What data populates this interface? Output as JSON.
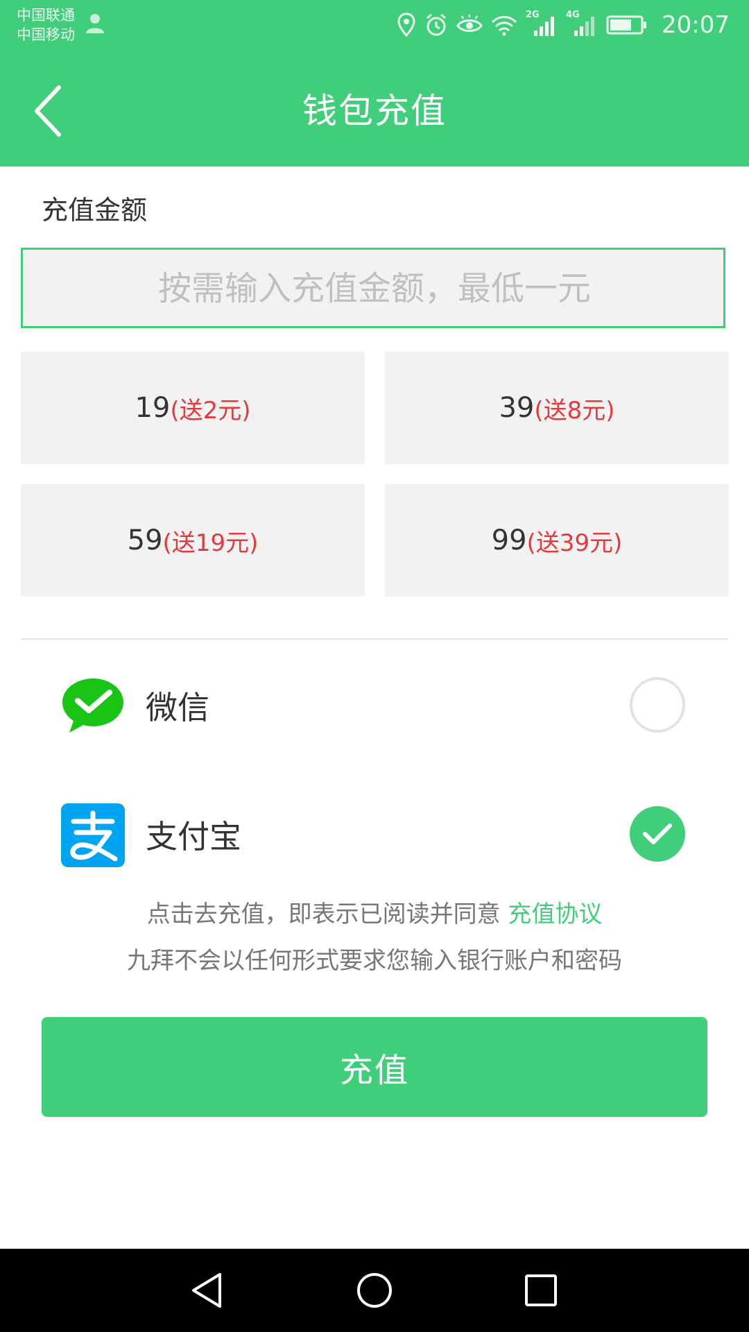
{
  "status_bar": {
    "carrier_1": "中国联通",
    "carrier_2": "中国移动",
    "network_1": "2G",
    "network_2": "4G",
    "time": "20:07"
  },
  "toolbar": {
    "title": "钱包充值"
  },
  "amount": {
    "label": "充值金额",
    "placeholder": "按需输入充值金额，最低一元",
    "presets": [
      {
        "amount": "19",
        "bonus": "(送2元)"
      },
      {
        "amount": "39",
        "bonus": "(送8元)"
      },
      {
        "amount": "59",
        "bonus": "(送19元)"
      },
      {
        "amount": "99",
        "bonus": "(送39元)"
      }
    ]
  },
  "payment": {
    "methods": [
      {
        "label": "微信",
        "icon": "wechat-icon",
        "selected": false
      },
      {
        "label": "支付宝",
        "icon": "alipay-icon",
        "selected": true
      }
    ]
  },
  "notice": {
    "agreement_prefix": "点击去充值，即表示已阅读并同意 ",
    "agreement_link": "充值协议",
    "security": "九拜不会以任何形式要求您输入银行账户和密码"
  },
  "submit": {
    "label": "充值"
  },
  "colors": {
    "primary": "#41ce7b",
    "bonus_red": "#e4393c",
    "wechat_green": "#1ac415",
    "alipay_blue": "#00a4f0"
  }
}
